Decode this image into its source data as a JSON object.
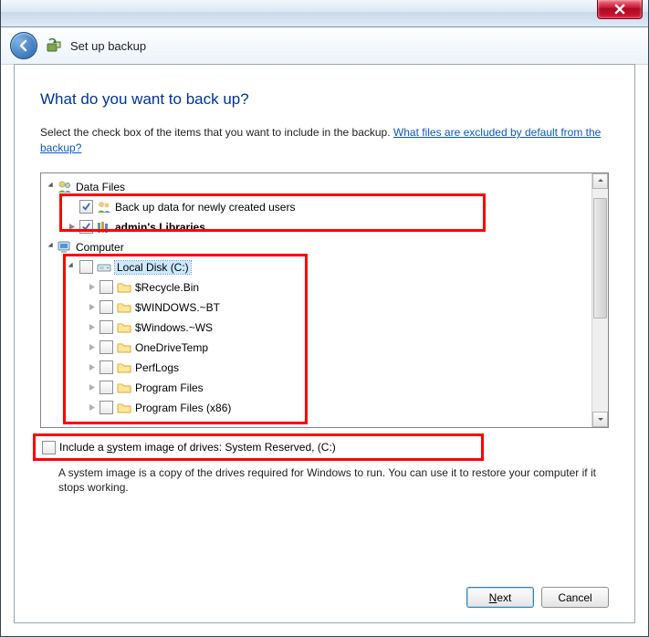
{
  "nav": {
    "title": "Set up backup"
  },
  "page": {
    "heading": "What do you want to back up?",
    "instruction_pre": "Select the check box of the items that you want to include in the backup. ",
    "instruction_link": "What files are excluded by default from the backup?"
  },
  "tree": {
    "data_files": {
      "label": "Data Files",
      "newly_created": "Back up data for newly created users",
      "admin_libs": "admin's Libraries"
    },
    "computer": {
      "label": "Computer",
      "local_disk": "Local Disk (C:)",
      "folders": [
        "$Recycle.Bin",
        "$WINDOWS.~BT",
        "$Windows.~WS",
        "OneDriveTemp",
        "PerfLogs",
        "Program Files",
        "Program Files (x86)"
      ]
    }
  },
  "sysimage": {
    "label_pre": "Include a ",
    "label_u": "s",
    "label_post": "ystem image of drives: System Reserved, (C:)",
    "desc": "A system image is a copy of the drives required for Windows to run. You can use it to restore your computer if it stops working."
  },
  "buttons": {
    "next_pre": "",
    "next_u": "N",
    "next_post": "ext",
    "cancel": "Cancel"
  }
}
